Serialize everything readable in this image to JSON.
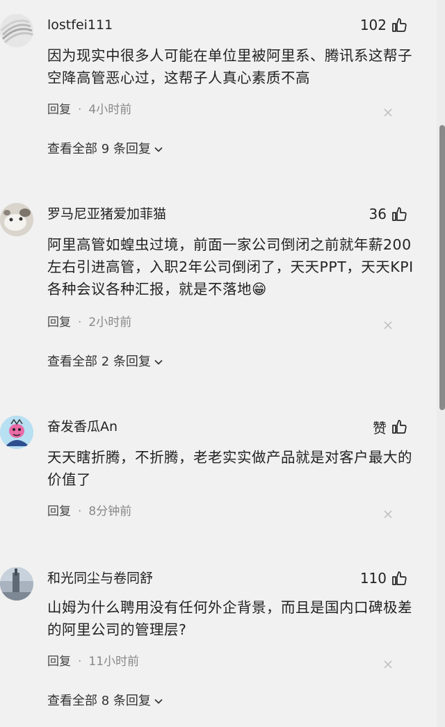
{
  "comments": [
    {
      "username": "lostfei111",
      "likes": "102",
      "text": "因为现实中很多人可能在单位里被阿里系、腾讯系这帮子空降高管恶心过，这帮子人真心素质不高",
      "reply_label": "回复",
      "time": "4小时前",
      "view_replies": "查看全部 9 条回复"
    },
    {
      "username": "罗马尼亚猪爱加菲猫",
      "likes": "36",
      "text": "阿里高管如蝗虫过境，前面一家公司倒闭之前就年薪200左右引进高管，入职2年公司倒闭了，天天PPT，天天KPI各种会议各种汇报，就是不落地😁",
      "reply_label": "回复",
      "time": "2小时前",
      "view_replies": "查看全部 2 条回复"
    },
    {
      "username": "奋发香瓜An",
      "likes": "赞",
      "text": "天天瞎折腾，不折腾，老老实实做产品就是对客户最大的价值了",
      "reply_label": "回复",
      "time": "8分钟前",
      "view_replies": ""
    },
    {
      "username": "和光同尘与卷同舒",
      "likes": "110",
      "text": "山姆为什么聘用没有任何外企背景，而且是国内口碑极差的阿里公司的管理层?",
      "reply_label": "回复",
      "time": "11小时前",
      "view_replies": "查看全部 8 条回复"
    }
  ],
  "dot": "·"
}
